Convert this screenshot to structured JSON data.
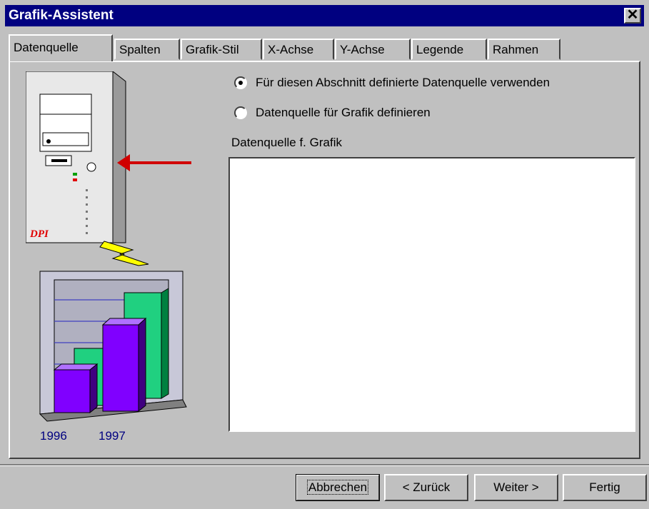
{
  "window": {
    "title": "Grafik-Assistent",
    "close_label": "✕"
  },
  "tabs": [
    {
      "label": "Datenquelle"
    },
    {
      "label": "Spalten"
    },
    {
      "label": "Grafik-Stil"
    },
    {
      "label": "X-Achse"
    },
    {
      "label": "Y-Achse"
    },
    {
      "label": "Legende"
    },
    {
      "label": "Rahmen"
    }
  ],
  "options": {
    "use_section": "Für diesen Abschnitt definierte Datenquelle verwenden",
    "define_graphic": "Datenquelle für Grafik definieren",
    "selected": "use_section"
  },
  "datasource": {
    "label": "Datenquelle f. Grafik",
    "value": ""
  },
  "illustration": {
    "computer_brand": "DPI",
    "year_labels": [
      "1996",
      "1997"
    ]
  },
  "buttons": {
    "cancel": "Abbrechen",
    "back": "< Zurück",
    "next": "Weiter >",
    "finish": "Fertig"
  }
}
